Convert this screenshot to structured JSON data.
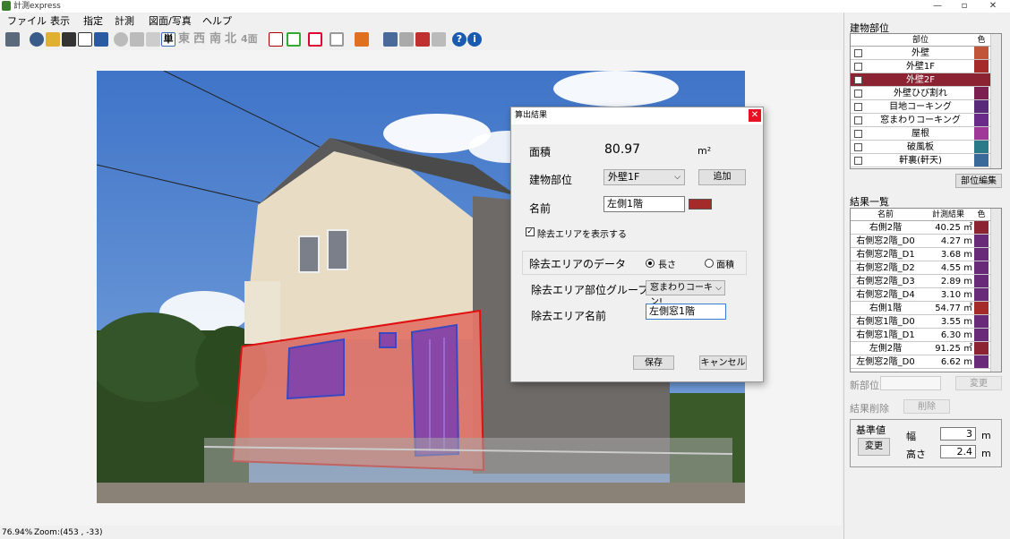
{
  "window": {
    "title": "計測express"
  },
  "menu": [
    "ファイル",
    "表示",
    "指定",
    "計測",
    "図面/写真",
    "ヘルプ"
  ],
  "toolbar": {
    "mode_single": "単",
    "dir_east": "東",
    "dir_west": "西",
    "dir_south": "南",
    "dir_north": "北",
    "four_sides": "4面"
  },
  "status": {
    "zoom_percent": "76.94%",
    "zoom_coords": "Zoom:(453 , -33)"
  },
  "building_parts": {
    "heading": "建物部位",
    "col_name": "部位",
    "col_color": "色",
    "items": [
      {
        "name": "外壁",
        "color": "#c0553a",
        "selected": false
      },
      {
        "name": "外壁1F",
        "color": "#a52a2a",
        "selected": false
      },
      {
        "name": "外壁2F",
        "color": "#8b2333",
        "selected": true
      },
      {
        "name": "外壁ひび割れ",
        "color": "#7b2050",
        "selected": false
      },
      {
        "name": "目地コーキング",
        "color": "#5a2a7a",
        "selected": false
      },
      {
        "name": "窓まわりコーキング",
        "color": "#6a2a8a",
        "selected": false
      },
      {
        "name": "屋根",
        "color": "#a0389a",
        "selected": false
      },
      {
        "name": "破風板",
        "color": "#2a7a8a",
        "selected": false
      },
      {
        "name": "軒裏(軒天)",
        "color": "#3a6a9a",
        "selected": false
      }
    ],
    "edit_button": "部位編集"
  },
  "results": {
    "heading": "結果一覧",
    "col_name": "名前",
    "col_value": "計測結果",
    "col_color": "色",
    "rows": [
      {
        "name": "右側2階",
        "value": "40.25 ㎡",
        "color": "#8b2333"
      },
      {
        "name": "右側窓2階_D0",
        "value": "4.27 m",
        "color": "#6a2a7a"
      },
      {
        "name": "右側窓2階_D1",
        "value": "3.68 m",
        "color": "#6a2a7a"
      },
      {
        "name": "右側窓2階_D2",
        "value": "4.55 m",
        "color": "#6a2a7a"
      },
      {
        "name": "右側窓2階_D3",
        "value": "2.89 m",
        "color": "#6a2a7a"
      },
      {
        "name": "右側窓2階_D4",
        "value": "3.10 m",
        "color": "#6a2a7a"
      },
      {
        "name": "右側1階",
        "value": "54.77 ㎡",
        "color": "#a52a2a"
      },
      {
        "name": "右側窓1階_D0",
        "value": "3.55 m",
        "color": "#6a2a7a"
      },
      {
        "name": "右側窓1階_D1",
        "value": "6.30 m",
        "color": "#6a2a7a"
      },
      {
        "name": "左側2階",
        "value": "91.25 ㎡",
        "color": "#8b2333"
      },
      {
        "name": "左側窓2階_D0",
        "value": "6.62 m",
        "color": "#6a2a7a"
      }
    ],
    "new_part_label": "新部位",
    "change_button": "変更",
    "delete_label": "結果削除",
    "delete_button": "削除"
  },
  "reference": {
    "heading": "基準値",
    "change_button": "変更",
    "width_label": "幅",
    "width_value": "3",
    "height_label": "高さ",
    "height_value": "2.4",
    "unit": "m"
  },
  "dialog": {
    "title": "算出結果",
    "area_label": "面積",
    "area_value": "80.97",
    "area_unit": "m²",
    "part_label": "建物部位",
    "part_value": "外壁1F",
    "add_button": "追加",
    "name_label": "名前",
    "name_value": "左側1階",
    "name_color": "#a52a2a",
    "show_removed_label": "除去エリアを表示する",
    "removed_data_label": "除去エリアのデータ",
    "radio_length": "長さ",
    "radio_area": "面積",
    "removed_group_label": "除去エリア部位グループ",
    "removed_group_value": "窓まわりコーキン!",
    "removed_name_label": "除去エリア名前",
    "removed_name_value": "左側窓1階",
    "save_button": "保存",
    "cancel_button": "キャンセル"
  }
}
